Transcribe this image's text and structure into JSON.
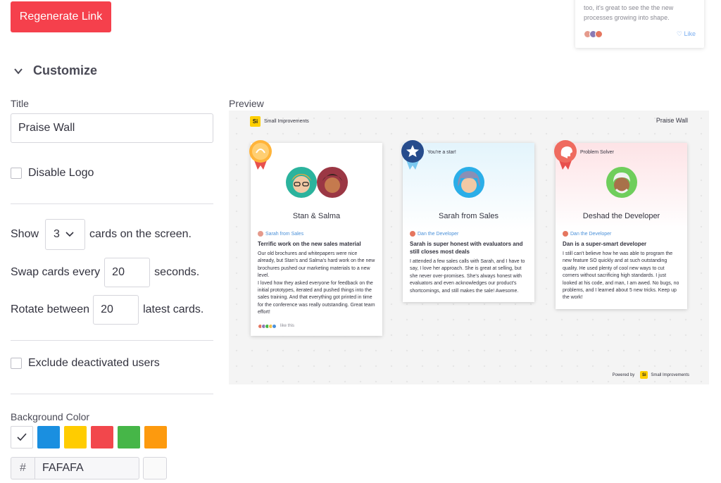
{
  "regenerate_label": "Regenerate Link",
  "top_card": {
    "text": "too, it's great to see the the new processes growing into shape.",
    "like_label": "Like"
  },
  "customize": {
    "heading": "Customize",
    "title_label": "Title",
    "title_value": "Praise Wall",
    "disable_logo_label": "Disable Logo",
    "show_prefix": "Show",
    "show_value": "3",
    "show_suffix": "cards on the screen.",
    "swap_prefix": "Swap cards every",
    "swap_value": "20",
    "swap_suffix": "seconds.",
    "rotate_prefix": "Rotate between",
    "rotate_value": "20",
    "rotate_suffix": "latest cards.",
    "exclude_label": "Exclude deactivated users",
    "bg_color_label": "Background Color",
    "swatch_colors": [
      "#ffffff",
      "#1a8fe0",
      "#ffcc00",
      "#f2474c",
      "#46b648",
      "#fd9a0e"
    ],
    "hex_prefix": "#",
    "hex_value": "FAFAFA"
  },
  "preview": {
    "label": "Preview",
    "logo_text": "Small Improvements",
    "logo_glyph": "Si",
    "wall_title": "Praise Wall",
    "powered_by": "Powered by",
    "powered_logo_text": "Small Improvements",
    "cards": [
      {
        "badge": "",
        "name": "Stan & Salma",
        "author": "Sarah from Sales",
        "title": "Terrific work on the new sales material",
        "text": "Our old brochures and whitepapers were nice already, but Stan's and Salma's hard work on the new brochures pushed our marketing materials to a new level.\nI loved how they asked everyone for feedback on the initial prototypes, iterated and pushed things into the sales training. And that everything got printed in time for the conference was really outstanding. Great team effort!",
        "likes": "like this"
      },
      {
        "badge": "You're a star!",
        "name": "Sarah from Sales",
        "author": "Dan the Developer",
        "title": "Sarah is super honest with evaluators and still closes most deals",
        "text": "I attended a few sales calls with Sarah, and I have to say, I love her approach. She is great at selling, but she never over-promises. She's always honest with evaluators and even acknowledges our product's shortcomings, and still makes the sale! Awesome."
      },
      {
        "badge": "Problem Solver",
        "name": "Deshad the Developer",
        "author": "Dan the Developer",
        "title": "Dan is a super-smart developer",
        "text": "I still can't believe how he was able to program the new feature SO quickly and at such outstanding quality. He used plenty of cool new ways to cut corners without sacrificing high standards. I just looked at his code, and man, I am awed. No bugs, no problems, and I learned about 5 new tricks. Keep up the work!"
      }
    ]
  }
}
